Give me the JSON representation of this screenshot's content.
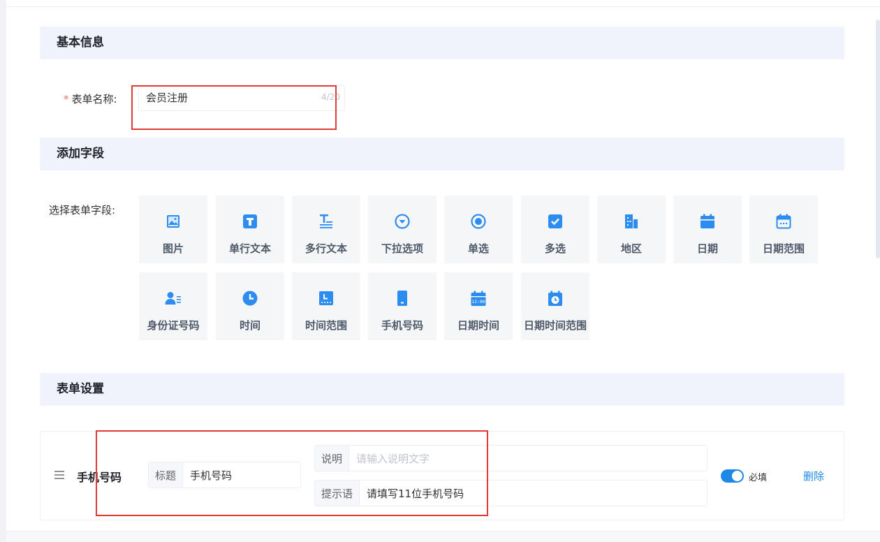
{
  "sections": {
    "basic_info": "基本信息",
    "add_fields": "添加字段",
    "form_settings": "表单设置"
  },
  "form_name": {
    "label": "表单名称:",
    "required_mark": "*",
    "value": "会员注册",
    "counter": "4/20"
  },
  "field_picker": {
    "label": "选择表单字段:",
    "tiles": [
      {
        "label": "图片",
        "icon": "image-icon"
      },
      {
        "label": "单行文本",
        "icon": "single-line-text-icon"
      },
      {
        "label": "多行文本",
        "icon": "multi-line-text-icon"
      },
      {
        "label": "下拉选项",
        "icon": "dropdown-icon"
      },
      {
        "label": "单选",
        "icon": "radio-icon"
      },
      {
        "label": "多选",
        "icon": "checkbox-icon"
      },
      {
        "label": "地区",
        "icon": "region-icon"
      },
      {
        "label": "日期",
        "icon": "date-icon"
      },
      {
        "label": "日期范围",
        "icon": "date-range-icon"
      },
      {
        "label": "身份证号码",
        "icon": "id-card-icon"
      },
      {
        "label": "时间",
        "icon": "clock-icon"
      },
      {
        "label": "时间范围",
        "icon": "time-range-icon"
      },
      {
        "label": "手机号码",
        "icon": "mobile-phone-icon"
      },
      {
        "label": "日期时间",
        "icon": "datetime-icon"
      },
      {
        "label": "日期时间范围",
        "icon": "datetime-range-icon"
      }
    ]
  },
  "setting_item": {
    "field_name": "手机号码",
    "title_label": "标题",
    "title_value": "手机号码",
    "desc_label": "说明",
    "desc_placeholder": "请输入说明文字",
    "hint_label": "提示语",
    "hint_value": "请填写11位手机号码",
    "required_label": "必填",
    "required_on": true,
    "delete_label": "删除"
  },
  "colors": {
    "accent": "#1e88e5",
    "header_bg": "#f0f3fc",
    "tile_bg": "#f5f6f7",
    "highlight": "#e53935"
  }
}
